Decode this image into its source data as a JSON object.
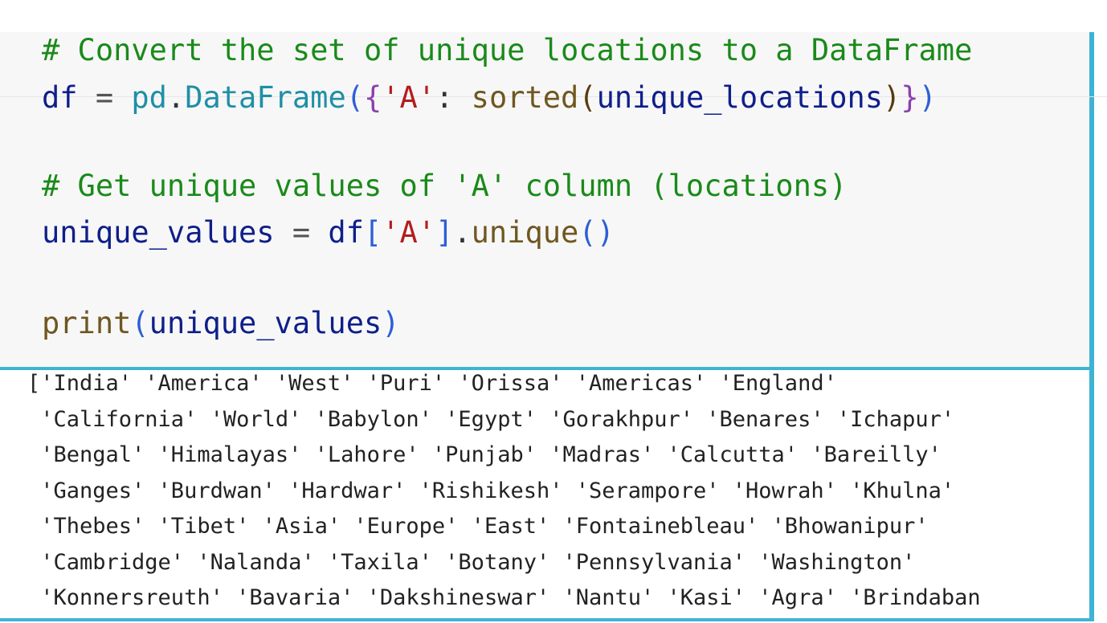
{
  "code": {
    "line1": {
      "comment": "# Convert the set of unique locations to a DataFrame"
    },
    "line2": {
      "var": "df",
      "assign": " = ",
      "module": "pd",
      "dot": ".",
      "cls": "DataFrame",
      "open_paren": "(",
      "open_brace": "{",
      "key": "'A'",
      "colon": ": ",
      "func": "sorted",
      "open_paren2": "(",
      "arg": "unique_locations",
      "close_paren2": ")",
      "close_brace": "}",
      "close_paren": ")"
    },
    "line3": {
      "comment": "# Get unique values of 'A' column (locations)"
    },
    "line4": {
      "var": "unique_values",
      "assign": " = ",
      "obj": "df",
      "open_bracket": "[",
      "key": "'A'",
      "close_bracket": "]",
      "dot": ".",
      "method": "unique",
      "parens": "()"
    },
    "line5": {
      "func": "print",
      "open_paren": "(",
      "arg": "unique_values",
      "close_paren": ")"
    }
  },
  "output": {
    "lines": [
      "['India' 'America' 'West' 'Puri' 'Orissa' 'Americas' 'England'",
      " 'California' 'World' 'Babylon' 'Egypt' 'Gorakhpur' 'Benares' 'Ichapur'",
      " 'Bengal' 'Himalayas' 'Lahore' 'Punjab' 'Madras' 'Calcutta' 'Bareilly'",
      " 'Ganges' 'Burdwan' 'Hardwar' 'Rishikesh' 'Serampore' 'Howrah' 'Khulna'",
      " 'Thebes' 'Tibet' 'Asia' 'Europe' 'East' 'Fontainebleau' 'Bhowanipur'",
      " 'Cambridge' 'Nalanda' 'Taxila' 'Botany' 'Pennsylvania' 'Washington'",
      " 'Konnersreuth' 'Bavaria' 'Dakshineswar' 'Nantu' 'Kasi' 'Agra' 'Brindaban"
    ]
  },
  "colors": {
    "accent": "#3fb3d4",
    "comment": "#1a8a1a",
    "string": "#b31d1d",
    "name": "#0e1f8a",
    "cell_background": "#f7f7f7"
  }
}
